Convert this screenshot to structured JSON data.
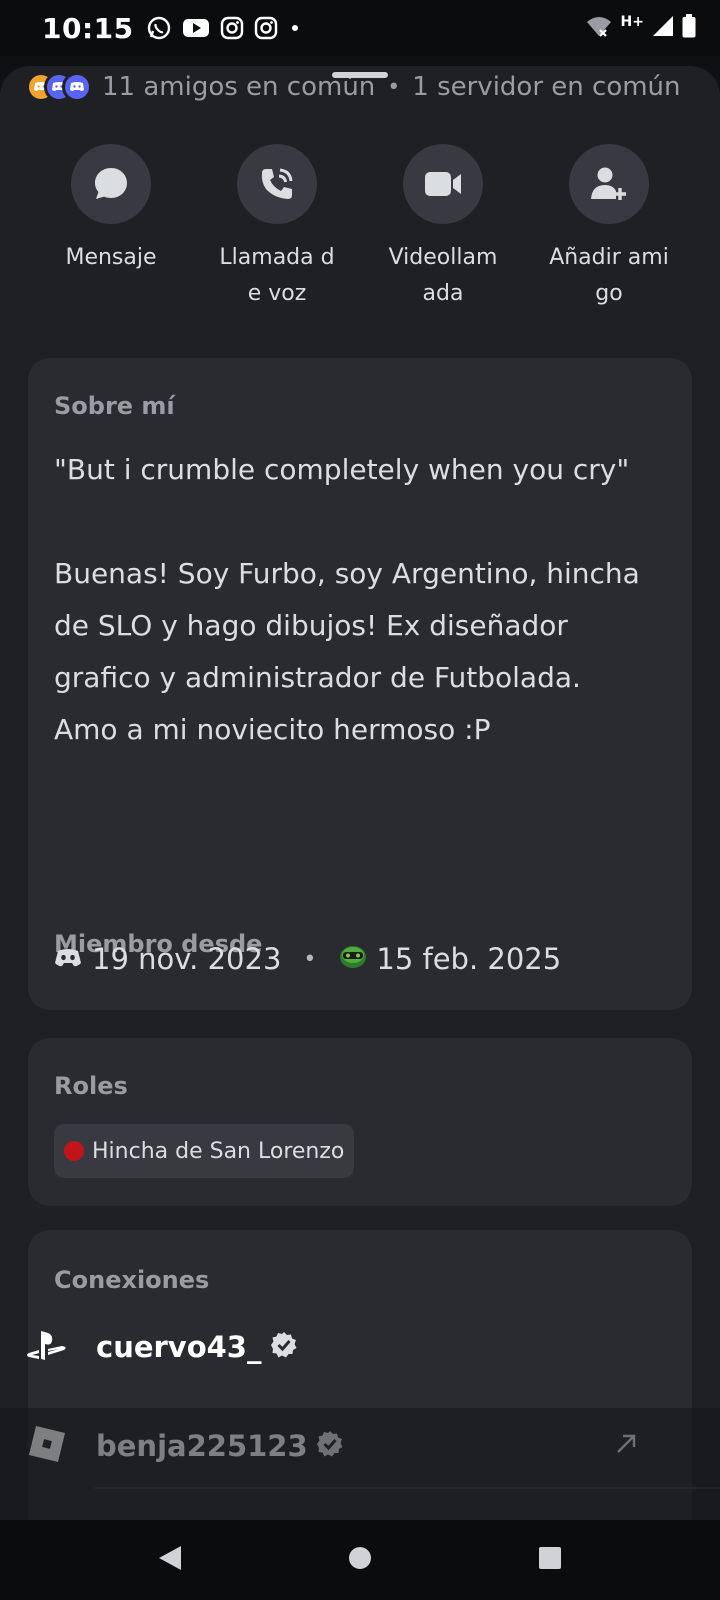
{
  "status_bar": {
    "time": "10:15",
    "notification_icons": [
      "whatsapp-icon",
      "youtube-icon",
      "instagram-icon",
      "instagram-icon",
      "dot-icon"
    ],
    "right_icons": [
      "wifi-off-icon",
      "network-hplus-icon",
      "signal-icon",
      "battery-icon"
    ],
    "network_label": "H+"
  },
  "mutuals": {
    "friends": "11 amigos en común",
    "servers": "1 servidor en común",
    "separator": "•"
  },
  "actions": [
    {
      "label": "Mensaje",
      "icon": "message-icon"
    },
    {
      "label": "Llamada de voz",
      "icon": "phone-call-icon"
    },
    {
      "label": "Videollamada",
      "icon": "video-camera-icon"
    },
    {
      "label": "Añadir amigo",
      "icon": "add-friend-icon"
    }
  ],
  "about": {
    "title": "Sobre mí",
    "bio": "\"But i crumble completely when you cry\"\n\nBuenas! Soy Furbo, soy Argentino, hincha de SLO y hago dibujos! Ex diseñador grafico y administrador de Futbolada.\nAmo a mi noviecito hermoso :P"
  },
  "member_since": {
    "title": "Miembro desde",
    "discord_date": "19 nov. 2023",
    "server_date": "15 feb. 2025",
    "separator": "•"
  },
  "roles": {
    "title": "Roles",
    "items": [
      {
        "name": "Hincha de San Lorenzo",
        "color": "#c1151b"
      }
    ]
  },
  "connections": {
    "title": "Conexiones",
    "items": [
      {
        "platform": "playstation-icon",
        "username": "cuervo43_",
        "verified": true
      },
      {
        "platform": "roblox-icon",
        "username": "benja225123",
        "verified": true,
        "external_link": true
      }
    ]
  },
  "colors": {
    "background": "#1f2024",
    "card": "#2a2b31",
    "button": "#393a41",
    "muted_text": "#9a9ca3",
    "discord_blurple": "#5865f2"
  }
}
